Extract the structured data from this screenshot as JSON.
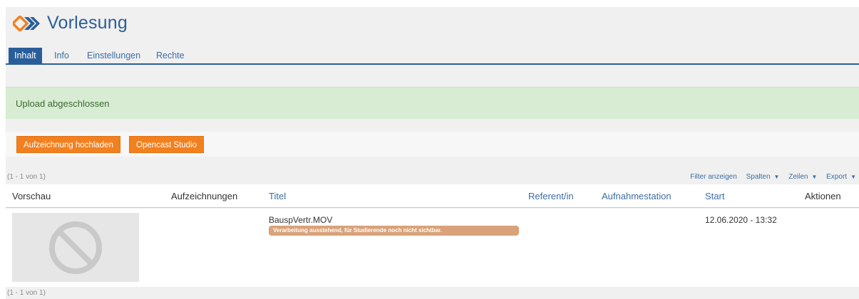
{
  "header": {
    "title": "Vorlesung",
    "logo_icon": "opencast-chevron-logo-icon"
  },
  "tabs": [
    {
      "label": "Inhalt",
      "active": true
    },
    {
      "label": "Info",
      "active": false
    },
    {
      "label": "Einstellungen",
      "active": false
    },
    {
      "label": "Rechte",
      "active": false
    }
  ],
  "alert": {
    "message": "Upload abgeschlossen"
  },
  "toolbar": {
    "upload_label": "Aufzeichnung hochladen",
    "studio_label": "Opencast Studio"
  },
  "table": {
    "range_top": "(1 - 1 von 1)",
    "range_bottom": "(1 - 1 von 1)",
    "tools": {
      "filter": "Filter anzeigen",
      "columns": "Spalten",
      "rows": "Zeilen",
      "export": "Export"
    },
    "columns": [
      "Vorschau",
      "Aufzeichnungen",
      "Titel",
      "Referent/in",
      "Aufnahmestation",
      "Start",
      "Aktionen"
    ],
    "rows": [
      {
        "title": "BauspVertr.MOV",
        "status": "Verarbeitung ausstehend, für Studierende noch nicht sichtbar.",
        "start": "12.06.2020 - 13:32",
        "preview_icon": "no-preview-icon"
      }
    ]
  },
  "colors": {
    "brand_blue": "#2a5e9a",
    "accent_orange": "#f2801f",
    "success_bg": "#d7ecd2",
    "badge": "#d9a27a"
  }
}
